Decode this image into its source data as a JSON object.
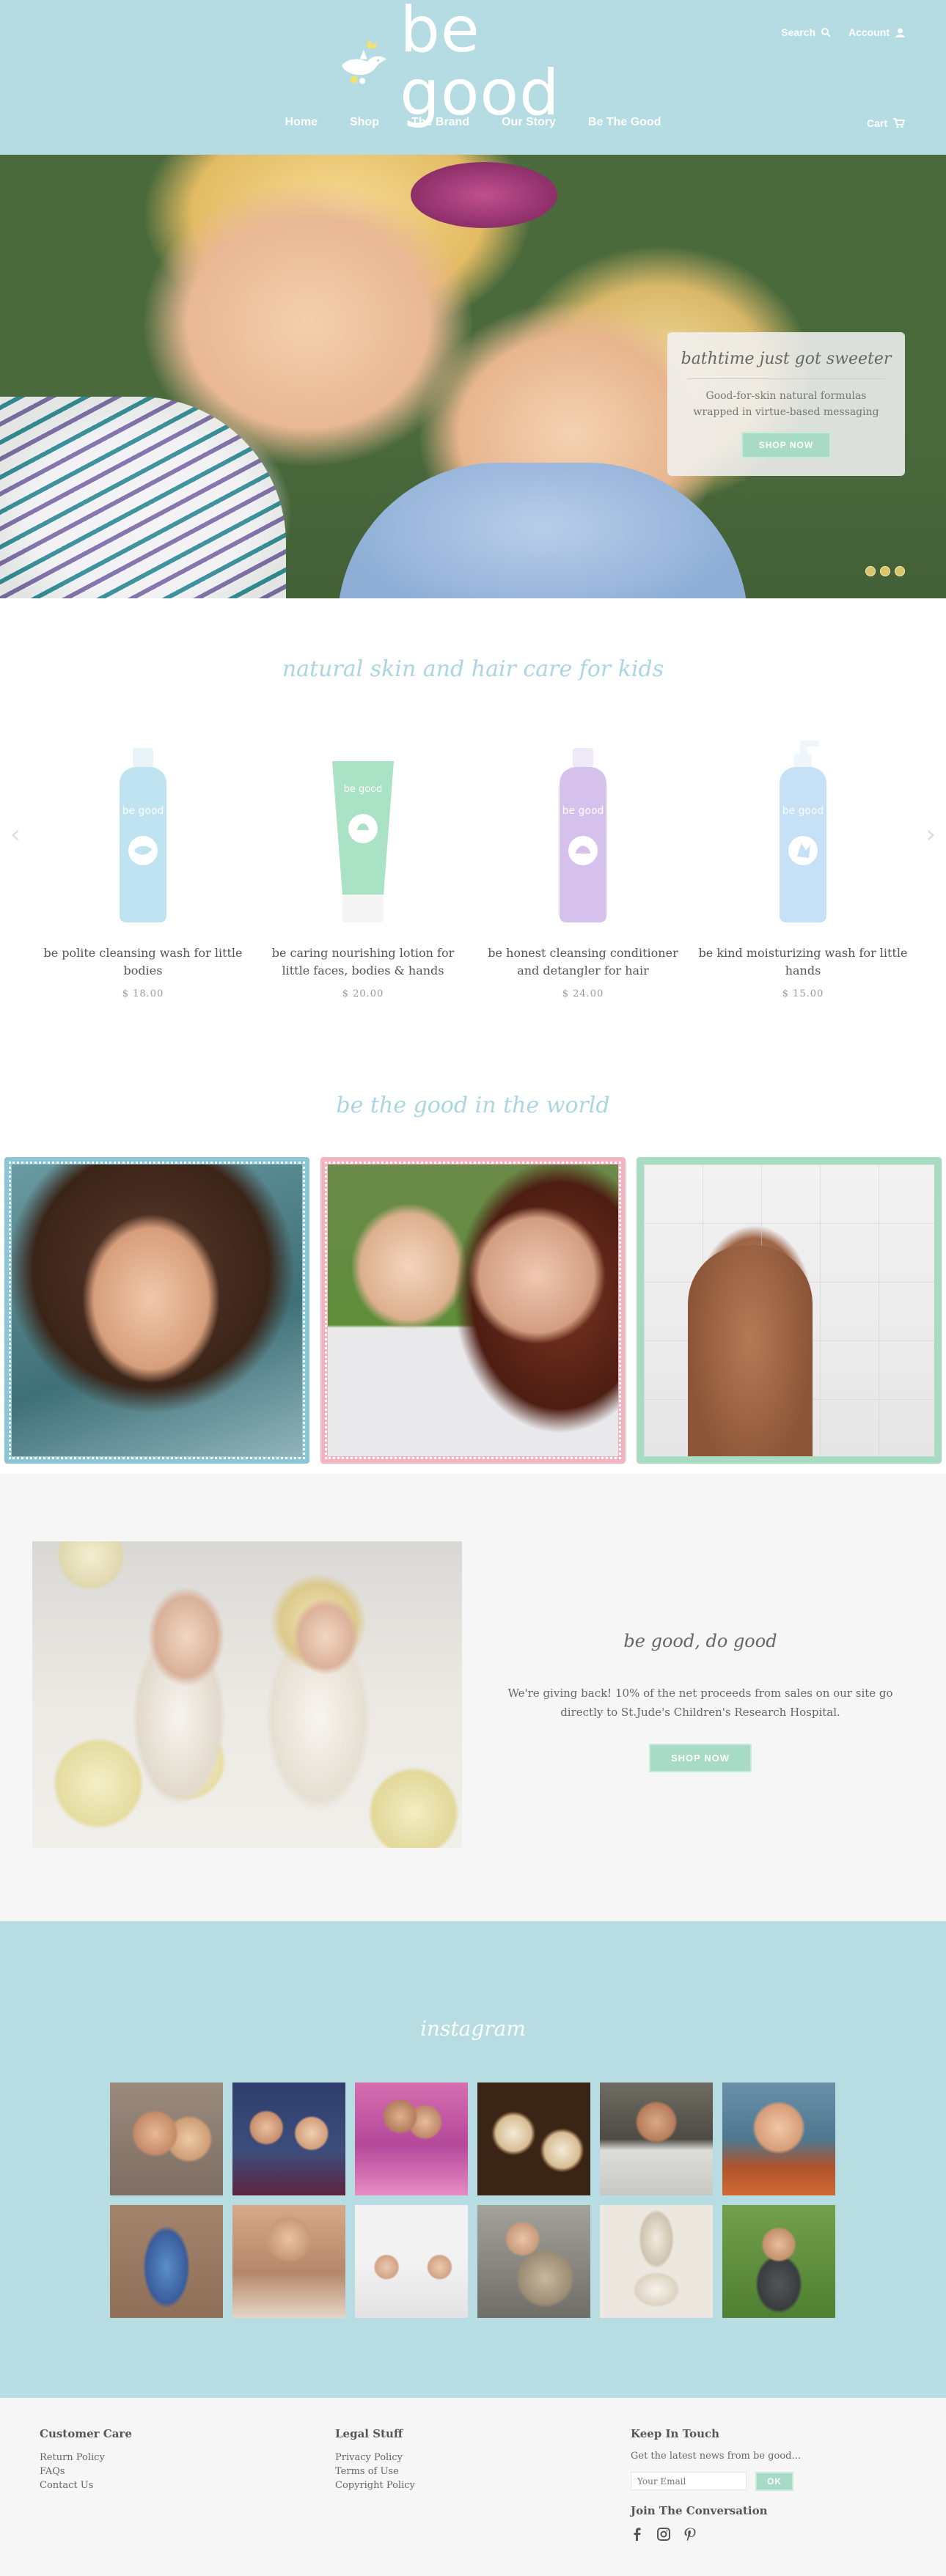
{
  "brand": {
    "name": "be good"
  },
  "header": {
    "search_label": "Search",
    "account_label": "Account",
    "cart_label": "Cart",
    "nav": [
      "Home",
      "Shop",
      "The Brand",
      "Our Story",
      "Be The Good"
    ]
  },
  "hero": {
    "headline": "bathtime just got sweeter",
    "body_line1": "Good-for-skin natural formulas",
    "body_line2": "wrapped in virtue-based messaging",
    "cta": "SHOP NOW",
    "slides": 3
  },
  "products": {
    "title": "natural skin and hair care for kids",
    "items": [
      {
        "name": "be polite cleansing wash for little bodies",
        "price": "$ 18.00",
        "color": "#bfe3f0"
      },
      {
        "name": "be caring nourishing lotion for little faces, bodies & hands",
        "price": "$ 20.00",
        "color": "#a9e2c5"
      },
      {
        "name": "be honest cleansing conditioner and detangler for hair",
        "price": "$ 24.00",
        "color": "#d6c0ec"
      },
      {
        "name": "be kind moisturizing wash for little hands",
        "price": "$ 15.00",
        "color": "#c6e0f5"
      }
    ]
  },
  "world": {
    "title": "be the good in the world"
  },
  "give_back": {
    "title": "be good, do good",
    "body": "We're giving back! 10% of the net proceeds from sales on our site go directly to St.Jude's Children's Research Hospital.",
    "cta": "SHOP NOW"
  },
  "instagram": {
    "title": "instagram"
  },
  "footer": {
    "customer_care": {
      "title": "Customer Care",
      "links": [
        "Return Policy",
        "FAQs",
        "Contact Us"
      ]
    },
    "legal": {
      "title": "Legal Stuff",
      "links": [
        "Privacy Policy",
        "Terms of Use",
        "Copyright Policy"
      ]
    },
    "keep_in_touch": {
      "title": "Keep In Touch",
      "text": "Get the latest news from be good...",
      "email_placeholder": "Your Email",
      "submit": "OK"
    },
    "join_title": "Join The Conversation"
  },
  "colors": {
    "header_bg": "#b5dce2",
    "accent_green": "#a7dbc5",
    "title_blue": "#a9d6e1"
  }
}
